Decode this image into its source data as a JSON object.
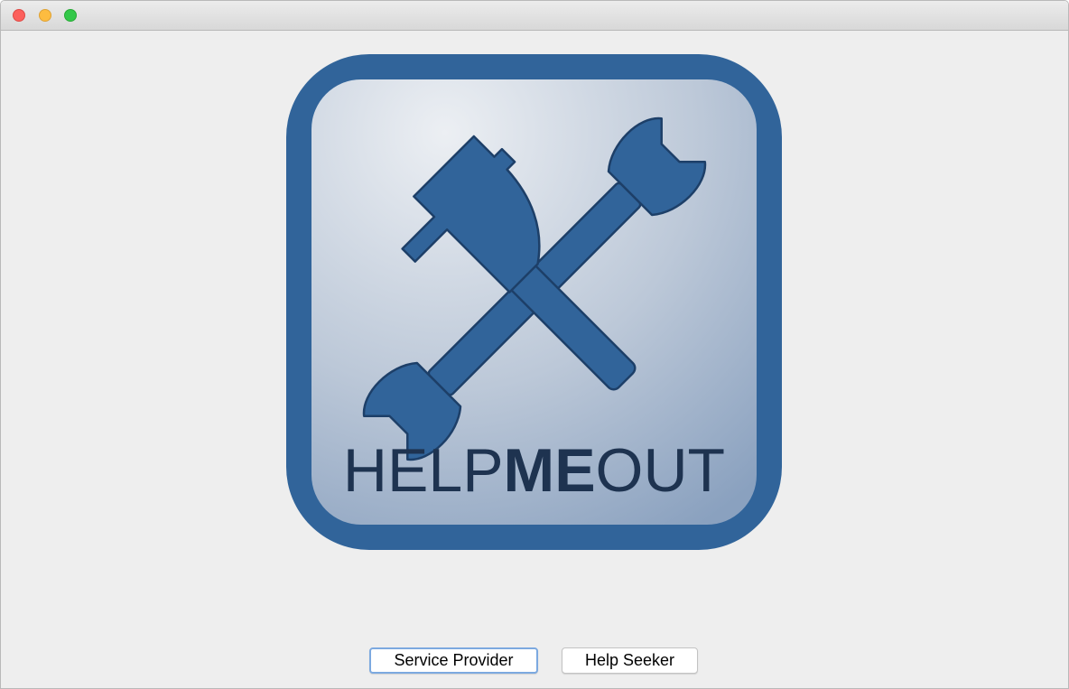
{
  "window": {
    "title": ""
  },
  "logo": {
    "text_light_1": "HELP",
    "text_bold": "ME",
    "text_light_2": "OUT",
    "icon": "hammer-wrench-icon",
    "colors": {
      "frame": "#31649a",
      "tool": "#31649a",
      "tool_outline": "#1d3f68",
      "text": "#1e3350",
      "gradient_light": "#e8ebef",
      "gradient_dark": "#8ea5c2"
    }
  },
  "buttons": {
    "service_provider": "Service Provider",
    "help_seeker": "Help Seeker"
  }
}
